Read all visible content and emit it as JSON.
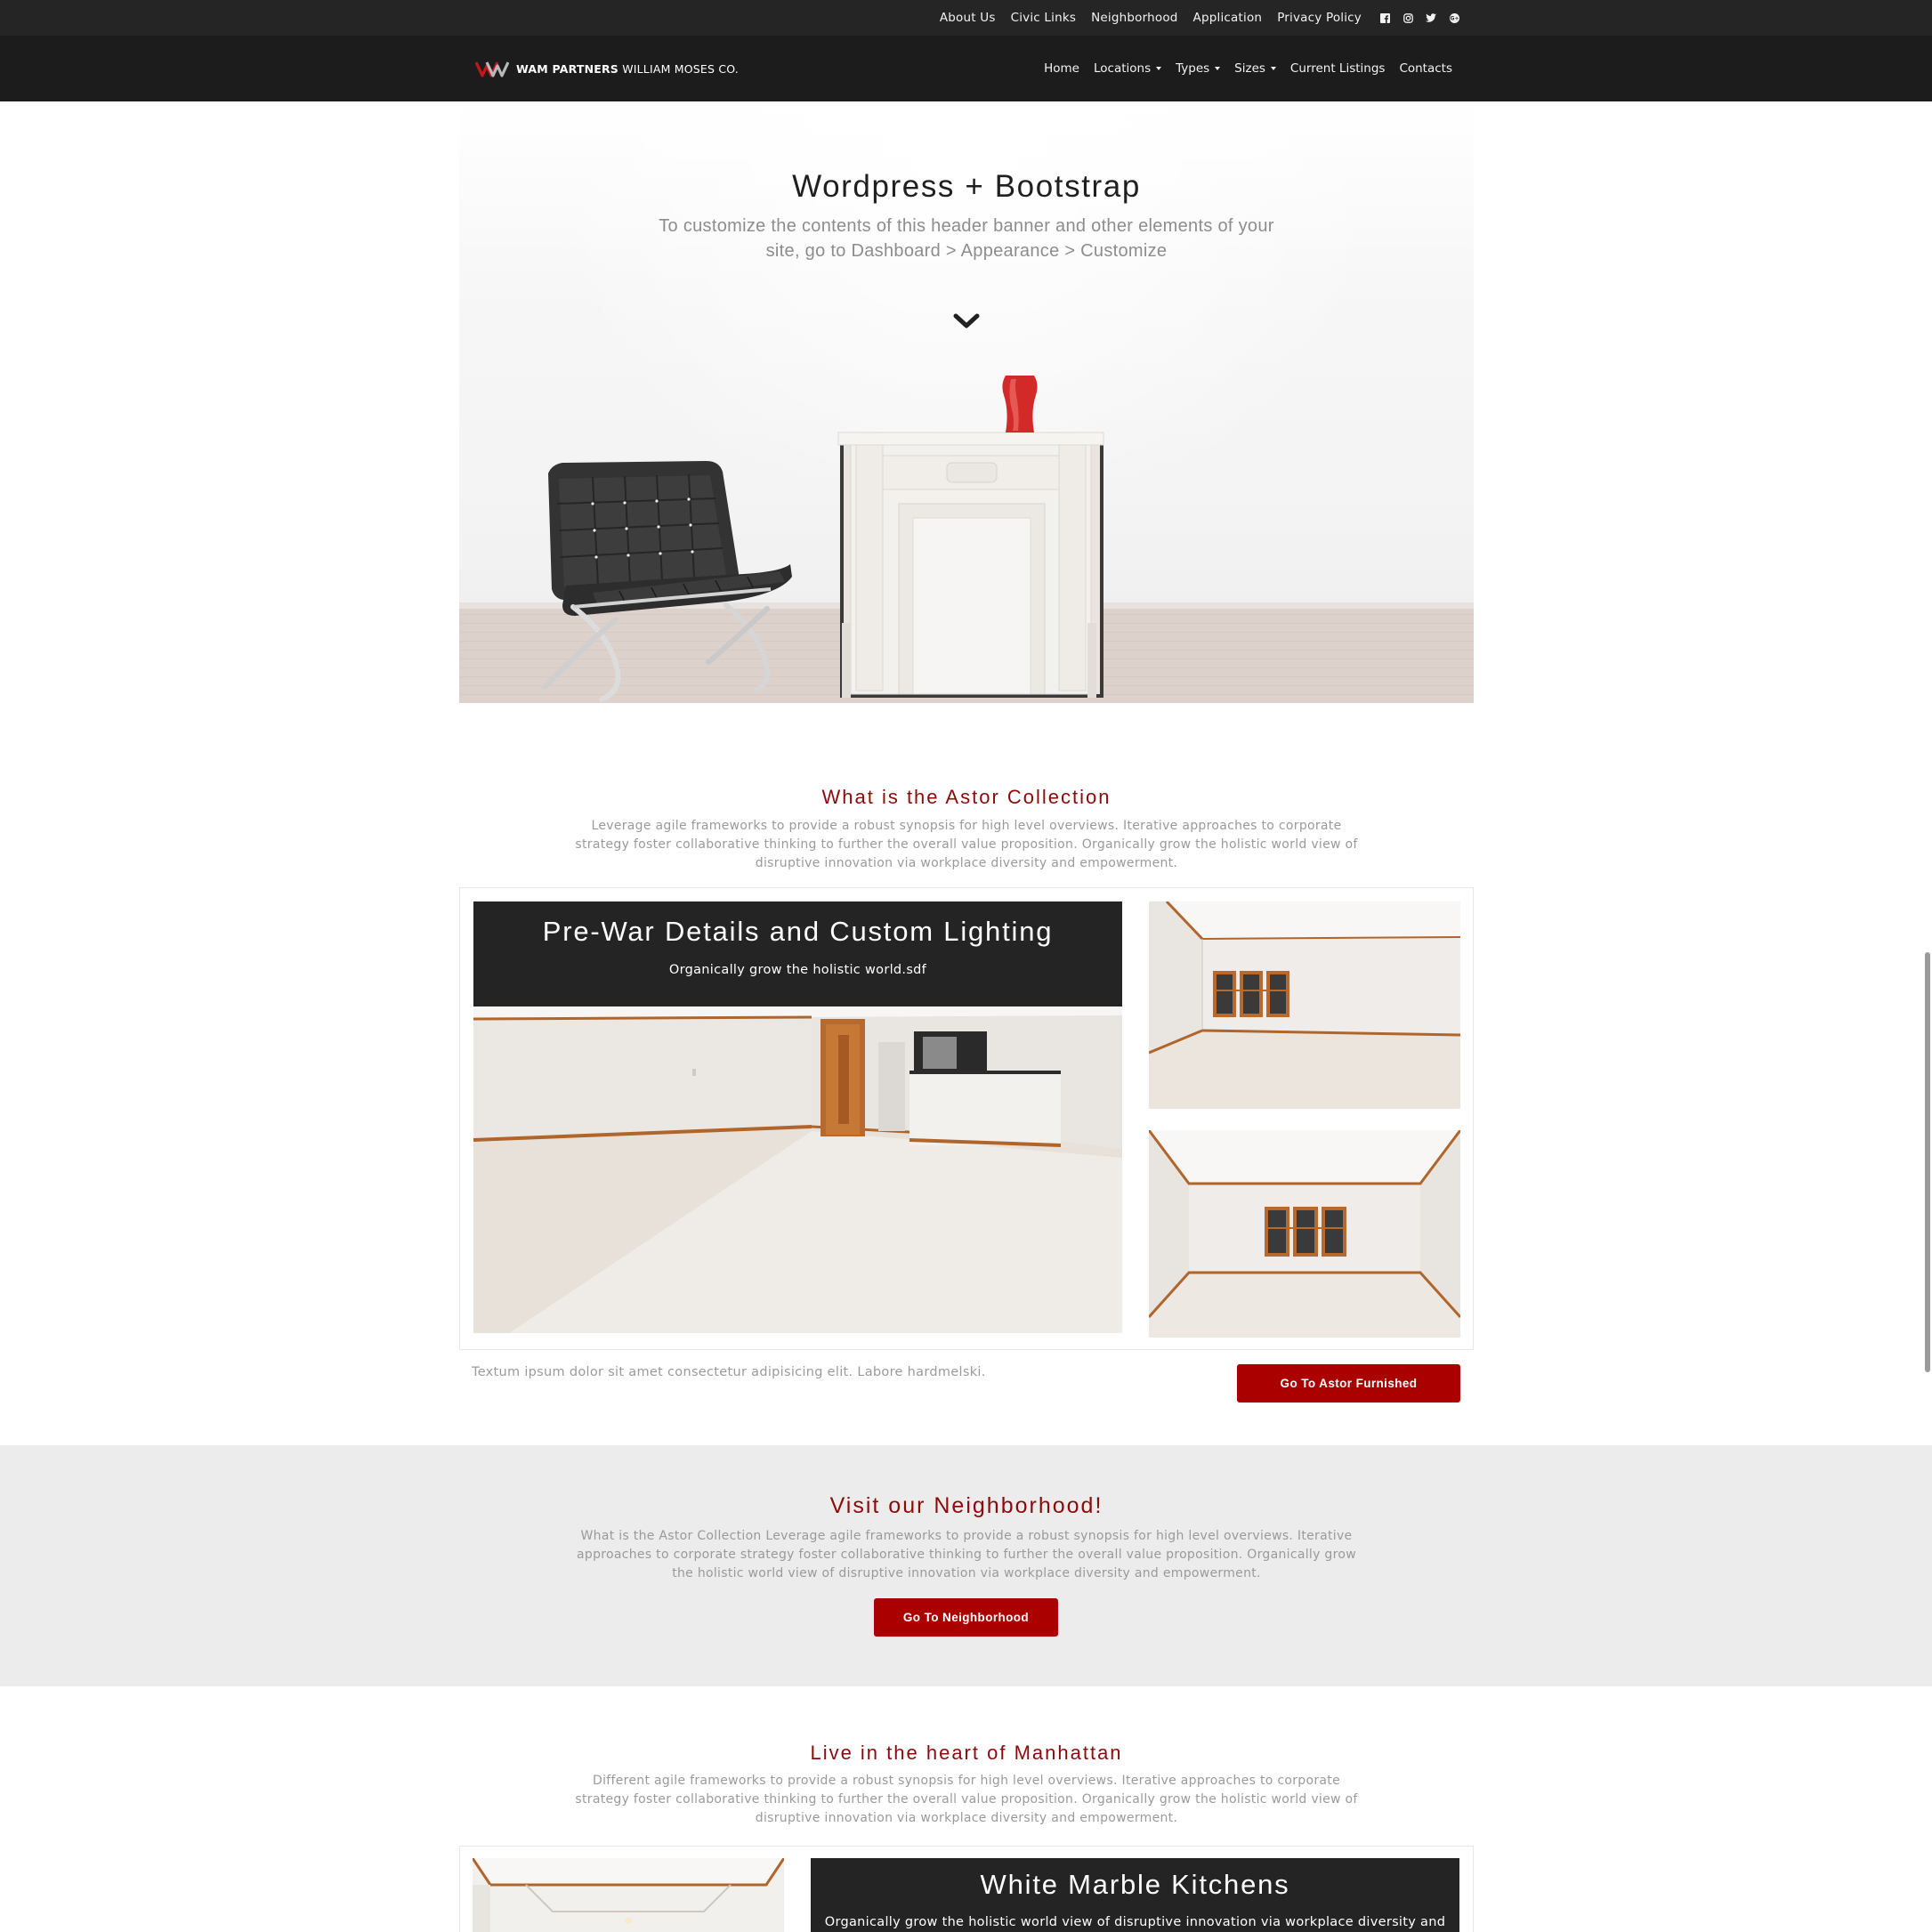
{
  "topbar": {
    "links": [
      "About Us",
      "Civic Links",
      "Neighborhood",
      "Application",
      "Privacy Policy"
    ],
    "social_icons": [
      "facebook-icon",
      "instagram-icon",
      "twitter-icon",
      "google-plus-icon"
    ]
  },
  "brand": {
    "bold": "WAM PARTNERS",
    "rest": "WILLIAM MOSES CO."
  },
  "nav": {
    "items": [
      {
        "label": "Home",
        "dropdown": false
      },
      {
        "label": "Locations",
        "dropdown": true
      },
      {
        "label": "Types",
        "dropdown": true
      },
      {
        "label": "Sizes",
        "dropdown": true
      },
      {
        "label": "Current Listings",
        "dropdown": false
      },
      {
        "label": "Contacts",
        "dropdown": false
      }
    ]
  },
  "hero": {
    "title": "Wordpress + Bootstrap",
    "subtitle": "To customize the contents of this header banner and other elements of your site, go to Dashboard > Appearance > Customize",
    "scroll_icon": "chevron-down-icon"
  },
  "astor": {
    "title": "What is the Astor Collection",
    "text": "Leverage agile frameworks to provide a robust synopsis for high level overviews. Iterative approaches to corporate strategy foster collaborative thinking to further the overall value proposition. Organically grow the holistic world view of disruptive innovation via workplace diversity and empowerment.",
    "feature_title": "Pre-War Details and Custom Lighting",
    "feature_subtitle": "Organically grow the holistic world.sdf",
    "caption": "Textum ipsum dolor sit amet consectetur adipisicing elit. Labore hardmelski.",
    "button": "Go To Astor Furnished"
  },
  "neighborhood": {
    "title": "Visit our Neighborhood!",
    "text": "What is the Astor Collection Leverage agile frameworks to provide a robust synopsis for high level overviews. Iterative approaches to corporate strategy foster collaborative thinking to further the overall value proposition. Organically grow the holistic world view of disruptive innovation via workplace diversity and empowerment.",
    "button": "Go To Neighborhood"
  },
  "manhattan": {
    "title": "Live in the heart of Manhattan",
    "text": "Different agile frameworks to provide a robust synopsis for high level overviews. Iterative approaches to corporate strategy foster collaborative thinking to further the overall value proposition. Organically grow the holistic world view of disruptive innovation via workplace diversity and empowerment.",
    "feature_title": "White Marble Kitchens",
    "feature_subtitle": "Organically grow the holistic world view of disruptive innovation via workplace diversity and"
  },
  "colors": {
    "accent": "#aa0000",
    "heading": "#8b0a0a",
    "nav_bg": "#1c1c1c",
    "topbar_bg": "#252525"
  }
}
